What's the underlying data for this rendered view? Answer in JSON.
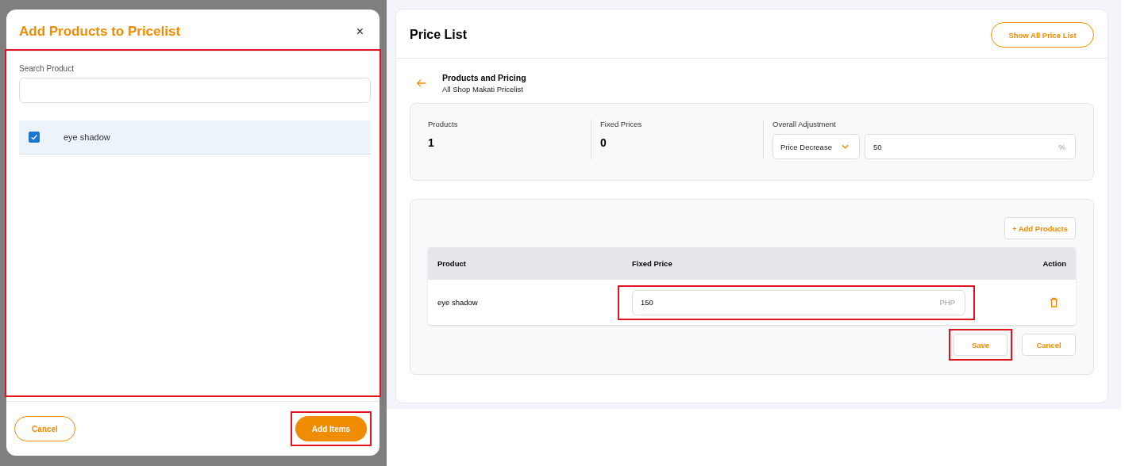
{
  "modal": {
    "title": "Add Products to Pricelist",
    "close": "×",
    "body_highlighted": true,
    "search": {
      "label": "Search Product"
    },
    "items": [
      {
        "name": "eye shadow",
        "checked": true
      }
    ],
    "cancel": "Cancel",
    "submit": {
      "label": "Add Items",
      "highlighted": true
    }
  },
  "page": {
    "title": "Price List",
    "show_all": "Show All Price List",
    "section_title": "Products and Pricing",
    "section_subtitle": "All Shop Makati Pricelist",
    "stats": [
      {
        "label": "Products",
        "value": "1"
      },
      {
        "label": "Fixed Prices",
        "value": "0"
      }
    ],
    "adjustment": {
      "label": "Overall Adjustment",
      "mode": "Price Decrease",
      "value": "50",
      "unit": "%"
    },
    "add_products": "+ Add Products",
    "columns": [
      "Product",
      "Fixed Price",
      "Action"
    ],
    "rows": [
      {
        "product": "eye shadow",
        "price": "150",
        "currency": "PHP",
        "highlighted": true
      }
    ],
    "save": {
      "label": "Save",
      "highlighted": true
    },
    "cancel": "Cancel"
  }
}
